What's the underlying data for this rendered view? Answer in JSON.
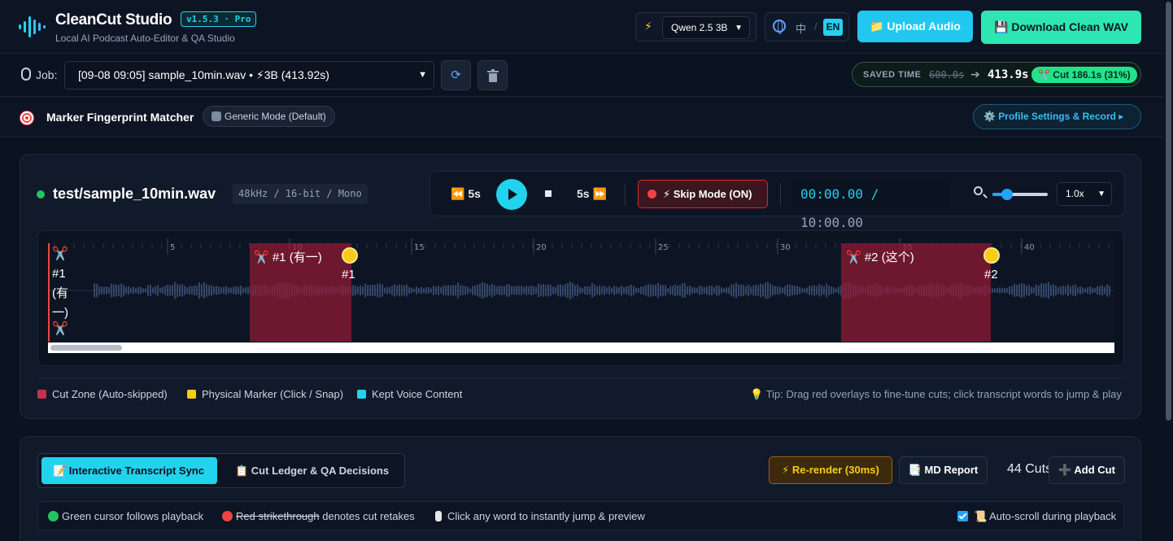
{
  "header": {
    "title": "CleanCut Studio",
    "version": "v1.5.3 · Pro",
    "subtitle": "Local AI Podcast Auto-Editor & QA Studio",
    "model_selected": "Qwen 2.5 3B",
    "lang_zh": "中",
    "lang_sep": "/",
    "lang_en": "EN",
    "upload_label": "📁 Upload Audio",
    "download_label": "💾 Download Clean WAV"
  },
  "jobbar": {
    "job_label": "Job:",
    "job_selected": "[09-08 09:05] sample_10min.wav • ⚡3B (413.92s)",
    "saved_label": "SAVED TIME",
    "saved_old": "600.0s",
    "saved_arrow": "➔",
    "saved_new": "413.9s",
    "saved_cut": "✂️ Cut 186.1s (31%)"
  },
  "markerbar": {
    "title": "Marker Fingerprint Matcher",
    "mode": "Generic Mode (Default)",
    "profile_button": "⚙️ Profile Settings & Record ▸"
  },
  "player": {
    "file_name": "test/sample_10min.wav",
    "file_meta": "48kHz / 16-bit / Mono",
    "back_label": "⏪ 5s",
    "fwd_label": "5s ⏩",
    "skip_label": "⚡ Skip Mode (ON)",
    "time_current": "00:00.00",
    "time_sep": "/",
    "time_total": "10:00.00",
    "zoom_level": 0.2,
    "speed": "1.0x"
  },
  "waveform": {
    "ticks": [
      "5",
      "10",
      "15",
      "20",
      "25",
      "30",
      "35",
      "40"
    ],
    "start_label_lines": [
      "#1",
      "(有",
      "一)"
    ],
    "cuts": [
      {
        "label": "✂️ #1 (有一)",
        "marker": "#1"
      },
      {
        "label": "✂️ #2 (这个)",
        "marker": "#2"
      }
    ]
  },
  "legend": {
    "cut_zone": "Cut Zone (Auto-skipped)",
    "physical_marker": "Physical Marker (Click / Snap)",
    "kept_voice": "Kept Voice Content",
    "tip": "💡 Tip: Drag red overlays to fine-tune cuts; click transcript words to jump & play"
  },
  "transcript": {
    "tab_active": "📝 Interactive Transcript Sync",
    "tab_other": "📋 Cut Ledger & QA Decisions",
    "rerender": "⚡ Re-render (30ms)",
    "md_report": "📑 MD Report",
    "cuts_count": "44 Cuts",
    "add_cut": "➕ Add Cut",
    "hint_green": "Green cursor follows playback",
    "hint_red_strike": "Red strikethrough",
    "hint_red_rest": " denotes cut retakes",
    "hint_click": "Click any word to instantly jump & preview",
    "autoscroll": "📜 Auto-scroll during playback"
  },
  "colors": {
    "accent": "#22d3ee",
    "cut_zone": "#c0344d",
    "marker": "#facc15",
    "kept": "#22d3ee",
    "download": "#2ee6b4"
  }
}
